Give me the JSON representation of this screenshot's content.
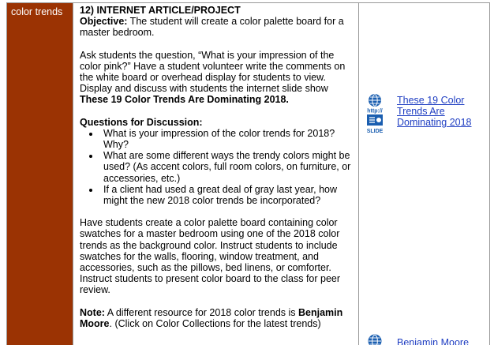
{
  "topic": "color trends",
  "section": {
    "number_title": "12)  INTERNET ARTICLE/PROJECT",
    "objective_label": "Objective:",
    "objective_text": " The student will create a color palette board for a master bedroom.",
    "intro_text": "Ask students the question, “What is your impression of the color pink?” Have a student volunteer write the comments on the white board or overhead display for students to view. Display and discuss with students the internet slide show ",
    "slide_title": "These 19 Color Trends Are Dominating 2018.",
    "questions_label": "Questions for Discussion:",
    "questions": [
      "What is your impression of the color trends for 2018? Why?",
      "What are some different ways the trendy colors might be used? (As accent colors, full room colors, on furniture, or accessories, etc.)",
      "If a client had used a great deal of gray last year, how might the new 2018 color trends be incorporated?"
    ],
    "activity_text": "Have students create a color palette board containing color swatches for a master bedroom using one of the 2018 color trends as the background color. Instruct students to include swatches for the walls, flooring, window treatment, and accessories, such as the pillows, bed linens, or comforter. Instruct students to present color board to the class for peer review.",
    "note_label": "Note:",
    "note_text_1": " A different resource for 2018 color trends is ",
    "note_brand": "Benjamin Moore",
    "note_text_2": ". (Click on Color Collections for the latest trends)"
  },
  "resources": [
    {
      "link": "These 19 Color Trends Are Dominating 2018",
      "icon": "internet-slide-icon",
      "icon_url_text": "http://",
      "icon_caption": "SLIDE"
    },
    {
      "link": "Benjamin Moore",
      "icon": "globe-icon"
    }
  ],
  "colors": {
    "topic_bg": "#9b3303",
    "link": "#1f3ec2",
    "icon": "#1a5eb0"
  }
}
